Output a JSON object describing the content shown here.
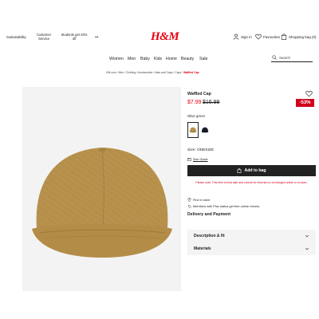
{
  "header": {
    "top_links": [
      "Sustainability",
      "Customer Service",
      "Students get 20% off",
      "•••"
    ],
    "logo_text": "H&M",
    "sign_in": "Sign in",
    "favourites": "Favourites",
    "shopping_bag": "Shopping bag (0)"
  },
  "nav": {
    "items": [
      "Women",
      "Men",
      "Baby",
      "Kids",
      "Home",
      "Beauty",
      "Sale"
    ],
    "search_placeholder": "Search"
  },
  "breadcrumb": {
    "trail": "HM.com / Men / Clothing / Accessories / Hats and Caps / Caps /",
    "current": "Waffled Cap"
  },
  "product": {
    "name": "Waffled Cap",
    "price": "$7.99",
    "old_price": "$16.99",
    "discount": "-53%",
    "color_name": "Olive green",
    "colors": [
      "#b9934e",
      "#1c1f2b"
    ],
    "size": "Size: ONESIZE",
    "size_guide": "Size Guide",
    "add_to_bag": "Add to bag",
    "notice": "Please note: This item is final sale and cannot be returned or exchanged online or in-store.",
    "find_in_store": "Find in store",
    "members_text": "Members with Plus status get free online returns.",
    "delivery_title": "Delivery and Payment",
    "accordions": [
      "Description & fit",
      "Materials"
    ]
  },
  "colors": {
    "brand_red": "#e50010",
    "sale_red": "#d0011b",
    "button_dark": "#222222"
  }
}
